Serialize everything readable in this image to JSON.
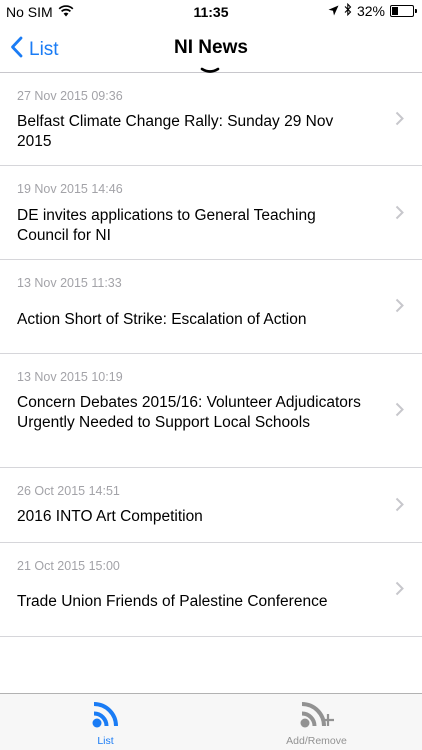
{
  "status_bar": {
    "carrier": "No SIM",
    "time": "11:35",
    "battery_percent": "32%",
    "battery_level": 0.32
  },
  "nav": {
    "back_label": "List",
    "title": "NI News"
  },
  "news": [
    {
      "date": "27 Nov 2015 09:36",
      "title": "Belfast Climate Change Rally: Sunday 29 Nov 2015"
    },
    {
      "date": "19 Nov 2015 14:46",
      "title": "DE invites applications to General Teaching Council for NI"
    },
    {
      "date": "13 Nov 2015 11:33",
      "title": "Action Short of Strike: Escalation of Action"
    },
    {
      "date": "13 Nov 2015 10:19",
      "title": "Concern Debates 2015/16: Volunteer Adjudicators Urgently Needed to Support Local Schools"
    },
    {
      "date": "26 Oct 2015 14:51",
      "title": "2016 INTO Art Competition"
    },
    {
      "date": "21 Oct 2015 15:00",
      "title": "Trade Union Friends of Palestine Conference"
    }
  ],
  "tabs": [
    {
      "label": "List",
      "icon": "rss-icon",
      "active": true
    },
    {
      "label": "Add/Remove",
      "icon": "rss-add-icon",
      "active": false
    }
  ],
  "colors": {
    "accent": "#1a7cf5",
    "inactive": "#929292",
    "date_text": "#a3a3a8"
  }
}
